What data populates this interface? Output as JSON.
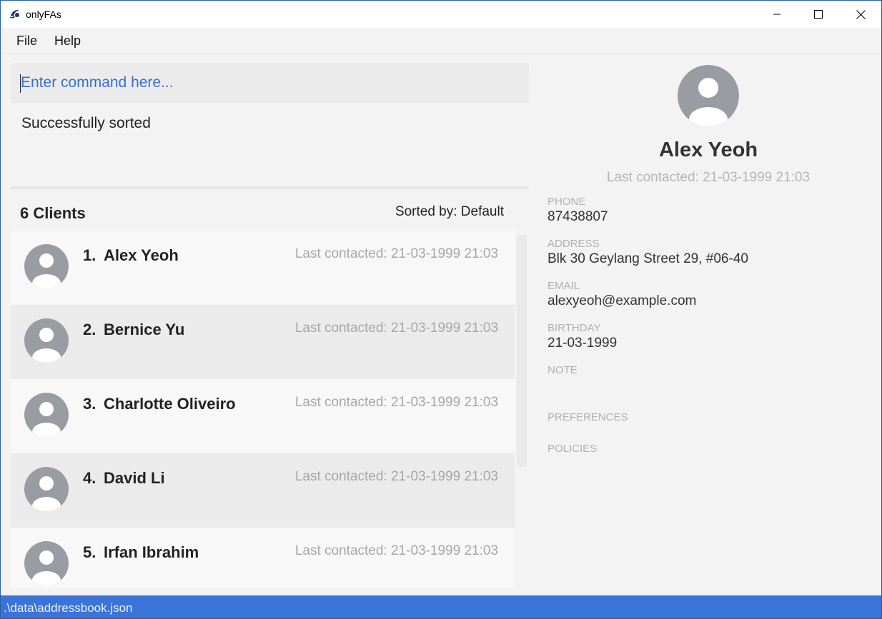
{
  "window": {
    "title": "onlyFAs"
  },
  "menu": {
    "items": [
      {
        "label": "File"
      },
      {
        "label": "Help"
      }
    ]
  },
  "command": {
    "placeholder": "Enter command here...",
    "value": ""
  },
  "result": {
    "message": "Successfully sorted"
  },
  "list": {
    "count_label": "6 Clients",
    "sorted_label": "Sorted by: Default",
    "clients": [
      {
        "index": "1.",
        "name": "Alex Yeoh",
        "contacted": "Last contacted: 21-03-1999 21:03"
      },
      {
        "index": "2.",
        "name": "Bernice Yu",
        "contacted": "Last contacted: 21-03-1999 21:03"
      },
      {
        "index": "3.",
        "name": "Charlotte Oliveiro",
        "contacted": "Last contacted: 21-03-1999 21:03"
      },
      {
        "index": "4.",
        "name": "David Li",
        "contacted": "Last contacted: 21-03-1999 21:03"
      },
      {
        "index": "5.",
        "name": "Irfan Ibrahim",
        "contacted": "Last contacted: 21-03-1999 21:03"
      }
    ]
  },
  "detail": {
    "name": "Alex Yeoh",
    "contacted": "Last contacted: 21-03-1999 21:03",
    "phone_label": "PHONE",
    "phone": "87438807",
    "address_label": "ADDRESS",
    "address": "Blk 30 Geylang Street 29, #06-40",
    "email_label": "EMAIL",
    "email": "alexyeoh@example.com",
    "birthday_label": "BIRTHDAY",
    "birthday": "21-03-1999",
    "note_label": "NOTE",
    "preferences_label": "PREFERENCES",
    "policies_label": "POLICIES"
  },
  "status": {
    "path": ".\\data\\addressbook.json"
  },
  "colors": {
    "accent": "#3a74d9",
    "placeholder": "#3a70cf",
    "avatar": "#9a9ca4"
  },
  "icons": {
    "app": "app-logo-icon",
    "avatar": "user-avatar-icon",
    "minimize": "minimize-icon",
    "maximize": "maximize-icon",
    "close": "close-icon"
  }
}
